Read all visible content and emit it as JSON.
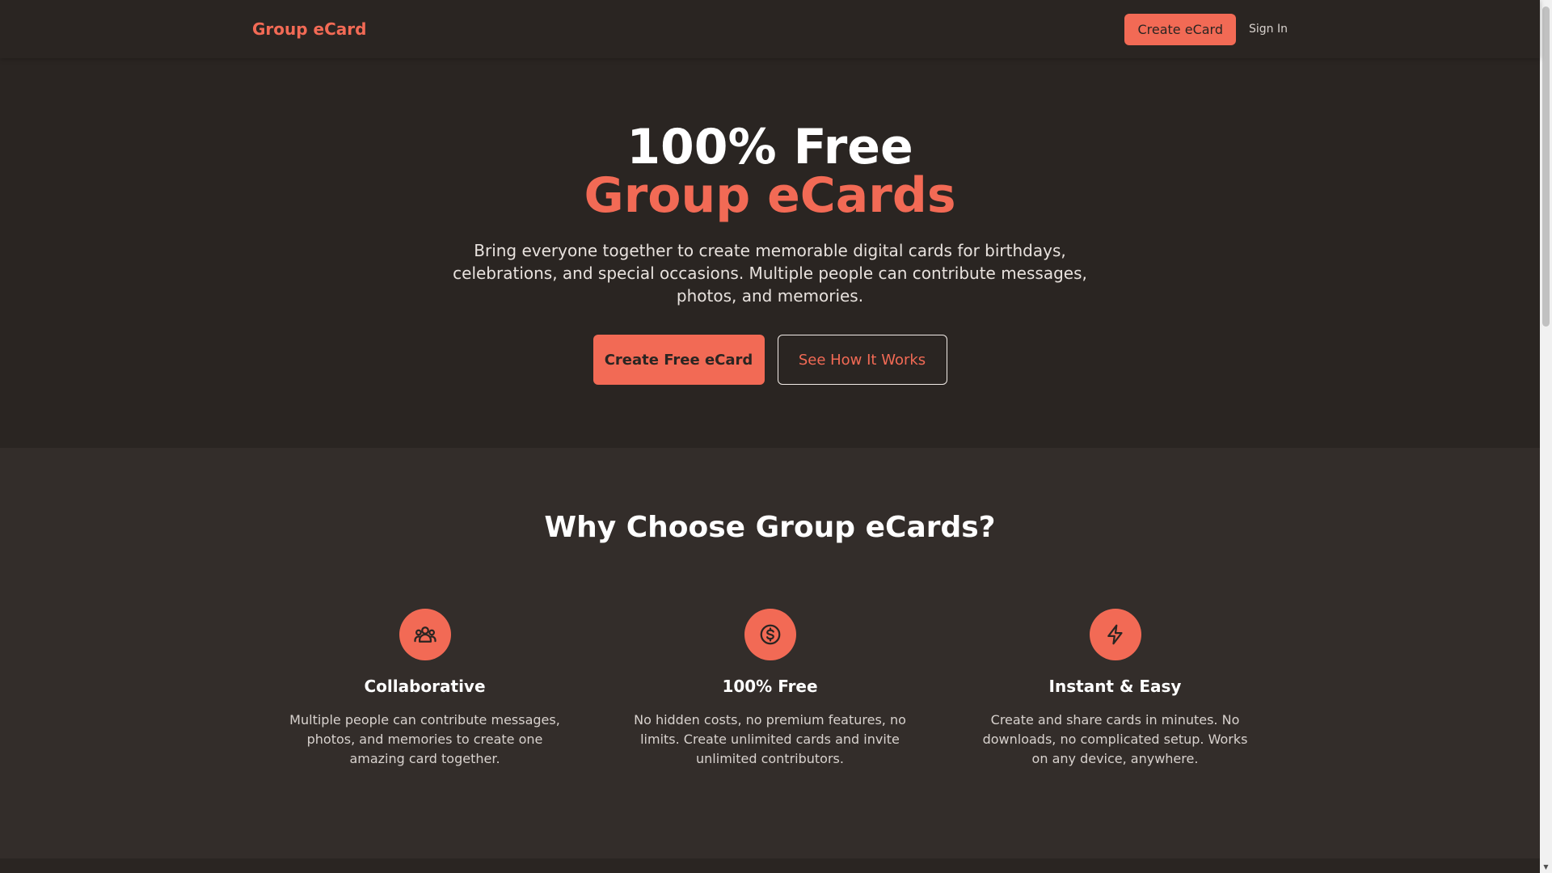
{
  "nav": {
    "brand": "Group eCard",
    "create_label": "Create eCard",
    "signin_label": "Sign In"
  },
  "hero": {
    "title_line1": "100% Free",
    "title_line2": "Group eCards",
    "subtitle": "Bring everyone together to create memorable digital cards for birthdays, celebrations, and special occasions. Multiple people can contribute messages, photos, and memories.",
    "primary_label": "Create Free eCard",
    "secondary_label": "See How It Works"
  },
  "features": {
    "title": "Why Choose Group eCards?",
    "items": [
      {
        "icon": "users-icon",
        "title": "Collaborative",
        "text": "Multiple people can contribute messages, photos, and memories to create one amazing card together."
      },
      {
        "icon": "dollar-icon",
        "title": "100% Free",
        "text": "No hidden costs, no premium features, no limits. Create unlimited cards and invite unlimited contributors."
      },
      {
        "icon": "lightning-icon",
        "title": "Instant & Easy",
        "text": "Create and share cards in minutes. No downloads, no complicated setup. Works on any device, anywhere."
      }
    ]
  },
  "colors": {
    "accent": "#f26a55",
    "background": "#2a2522",
    "section_background": "#332d2a"
  }
}
